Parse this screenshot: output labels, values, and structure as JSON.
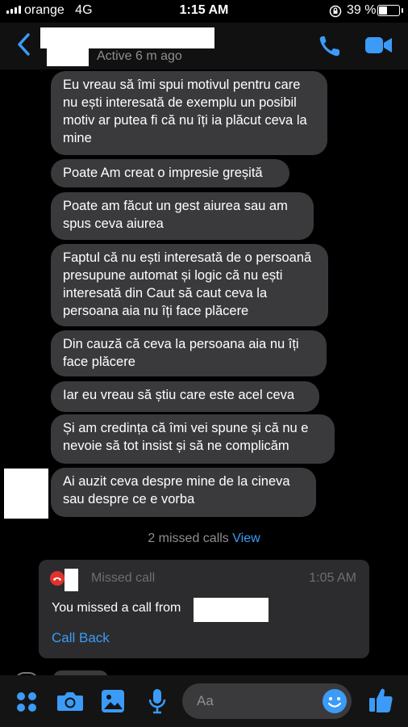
{
  "status_bar": {
    "carrier": "orange",
    "network": "4G",
    "time": "1:15 AM",
    "battery_percent": "39 %",
    "battery_level": 0.39
  },
  "header": {
    "active_status": "Active 6 m ago"
  },
  "messages": [
    "Eu vreau să îmi spui motivul pentru care nu ești interesată de exemplu un posibil motiv ar putea fi că nu îți ia plăcut ceva la mine",
    "Poate Am creat o impresie greșită",
    "Poate am făcut un gest aiurea sau am spus ceva aiurea",
    "Faptul că nu ești interesată de o persoană presupune automat și logic că nu ești interesată din Caut să caut ceva la persoana aia nu îți face plăcere",
    "Din cauză că ceva la persoana aia nu îți face plăcere",
    "Iar eu vreau să știu care este acel ceva",
    "Și am credința că îmi vei spune și că nu e nevoie să tot insist și să ne complicăm",
    "Ai auzit ceva despre mine de la cineva sau despre ce e vorba"
  ],
  "missed_summary": {
    "text": "2 missed calls",
    "link": "View"
  },
  "call_card": {
    "title": "Missed call",
    "time": "1:05 AM",
    "text": "You missed a call from",
    "action": "Call Back"
  },
  "composer": {
    "placeholder": "Aa"
  },
  "colors": {
    "accent": "#3b9bf7",
    "bubble": "#3a3a3c",
    "missed_red": "#e0332e"
  }
}
